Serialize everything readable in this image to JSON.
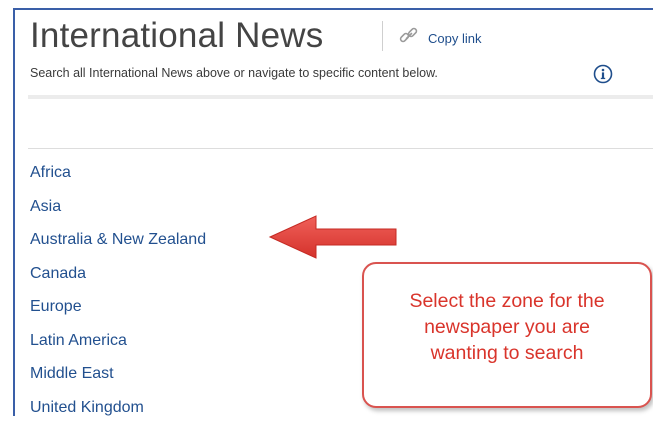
{
  "header": {
    "title": "International News",
    "copy_link_label": "Copy link",
    "link_icon": "link-icon",
    "subtitle": "Search all International News above or navigate to specific content below.",
    "info_icon": "info-icon"
  },
  "regions": [
    "Africa",
    "Asia",
    "Australia & New Zealand",
    "Canada",
    "Europe",
    "Latin America",
    "Middle East",
    "United Kingdom"
  ],
  "annotation": {
    "lines": [
      "Select the zone for the",
      "newspaper you are",
      "wanting to search"
    ],
    "color": "#d9342b",
    "arrow_color": "#e0403a"
  },
  "colors": {
    "link": "#22508f",
    "frame_border": "#3a5fa8",
    "title_text": "#444444"
  }
}
